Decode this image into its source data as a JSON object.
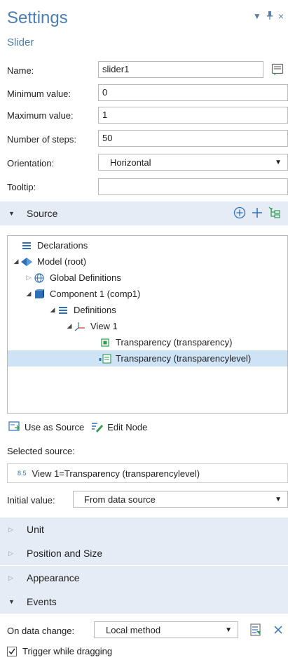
{
  "header": {
    "title": "Settings",
    "subtitle": "Slider"
  },
  "form": {
    "name": {
      "label": "Name:",
      "value": "slider1"
    },
    "min": {
      "label": "Minimum value:",
      "value": "0"
    },
    "max": {
      "label": "Maximum value:",
      "value": "1"
    },
    "steps": {
      "label": "Number of steps:",
      "value": "50"
    },
    "orientation": {
      "label": "Orientation:",
      "value": "Horizontal"
    },
    "tooltip": {
      "label": "Tooltip:",
      "value": ""
    }
  },
  "source_section": {
    "label": "Source"
  },
  "tree": [
    {
      "label": "Declarations"
    },
    {
      "label": "Model (root)"
    },
    {
      "label": "Global Definitions"
    },
    {
      "label": "Component 1 (comp1)"
    },
    {
      "label": "Definitions"
    },
    {
      "label": "View 1"
    },
    {
      "label": "Transparency (transparency)"
    },
    {
      "label": "Transparency (transparencylevel)"
    }
  ],
  "toolbar": {
    "use_as_source": "Use as Source",
    "edit_node": "Edit Node"
  },
  "selected_source": {
    "label": "Selected source:",
    "badge": "8.5",
    "value": "View 1=Transparency (transparencylevel)"
  },
  "initial_value": {
    "label": "Initial value:",
    "value": "From data source"
  },
  "sections": {
    "unit": "Unit",
    "position": "Position and Size",
    "appearance": "Appearance",
    "events": "Events"
  },
  "events": {
    "on_change_label": "On data change:",
    "on_change_value": "Local method",
    "trigger_label": "Trigger while dragging",
    "trigger_checked": true
  },
  "colors": {
    "accent": "#4a7fb5",
    "section_bg": "#e6ecf5",
    "selection_bg": "#cfe3f7",
    "icon_green": "#2e9b4f"
  }
}
